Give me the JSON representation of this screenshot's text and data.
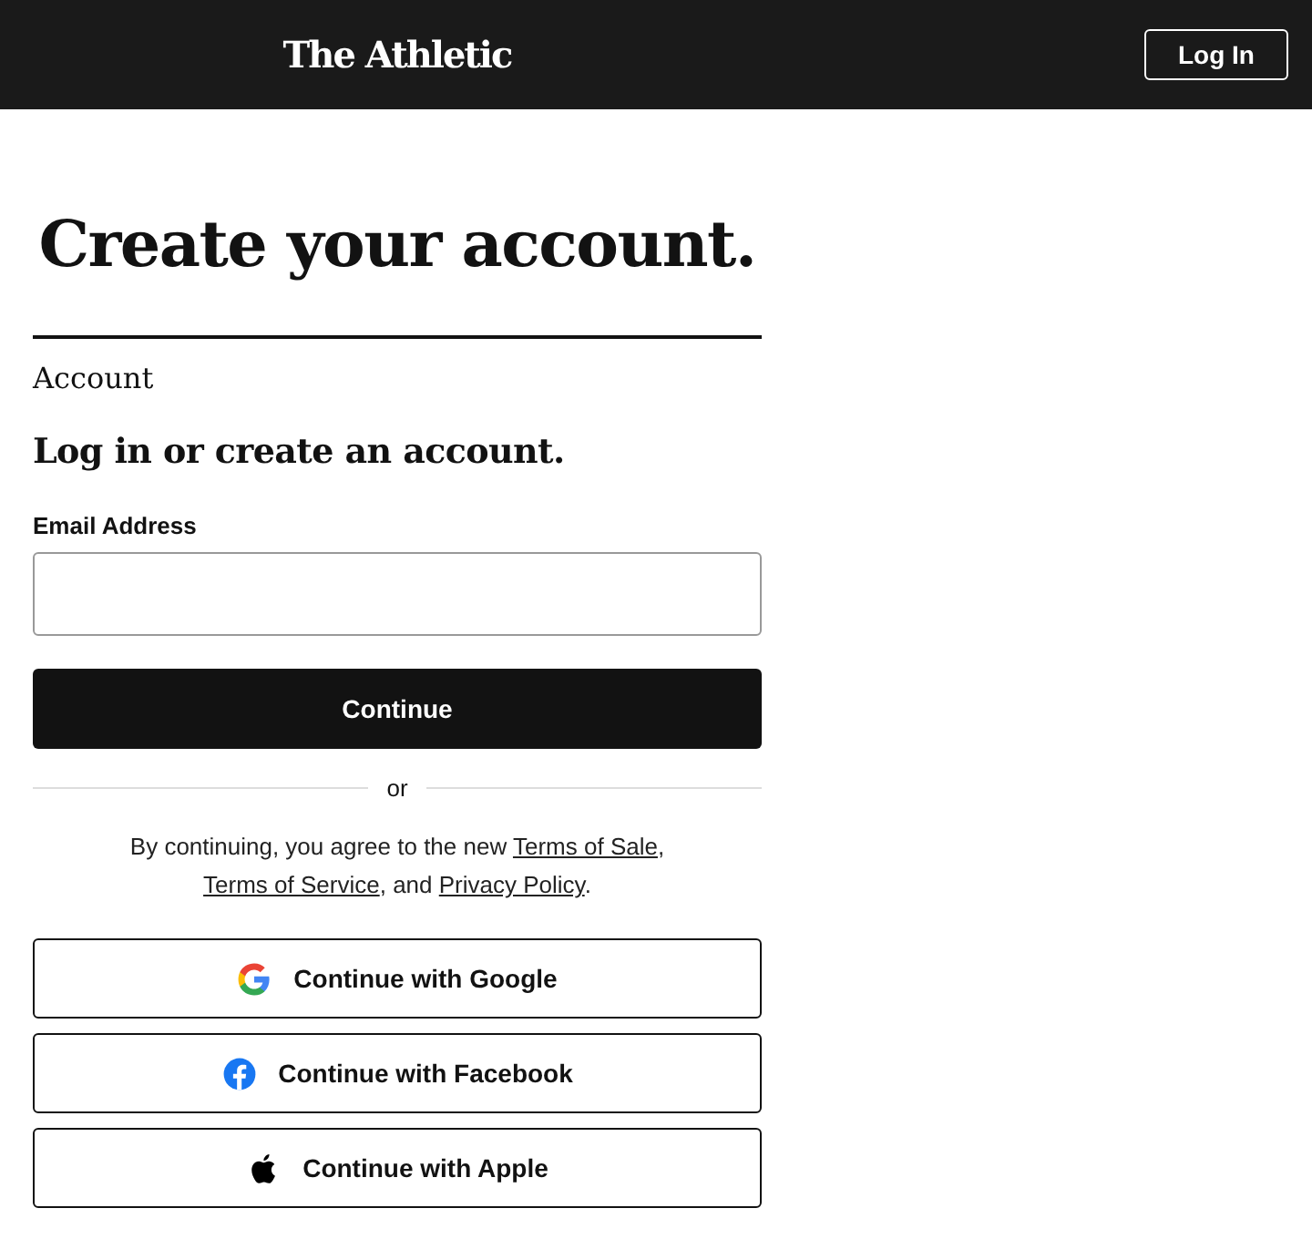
{
  "header": {
    "logo": "The Athletic",
    "login_button": "Log In"
  },
  "title": "Create your account.",
  "section_label": "Account",
  "heading": "Log in or create an account.",
  "email_field": {
    "label": "Email Address"
  },
  "continue_button": "Continue",
  "divider_text": "or",
  "legal": [
    {
      "kind": "text",
      "text": "By continuing, you agree to the new "
    },
    {
      "kind": "link",
      "text": "Terms of Sale"
    },
    {
      "kind": "text",
      "text": ", "
    },
    {
      "kind": "link",
      "text": "Terms of Service"
    },
    {
      "kind": "text",
      "text": ", and "
    },
    {
      "kind": "link",
      "text": "Privacy Policy"
    },
    {
      "kind": "text",
      "text": "."
    }
  ],
  "social_buttons": [
    {
      "kind": "google",
      "label": "Continue with Google"
    },
    {
      "kind": "facebook",
      "label": "Continue with Facebook"
    },
    {
      "kind": "apple",
      "label": "Continue with Apple"
    }
  ]
}
